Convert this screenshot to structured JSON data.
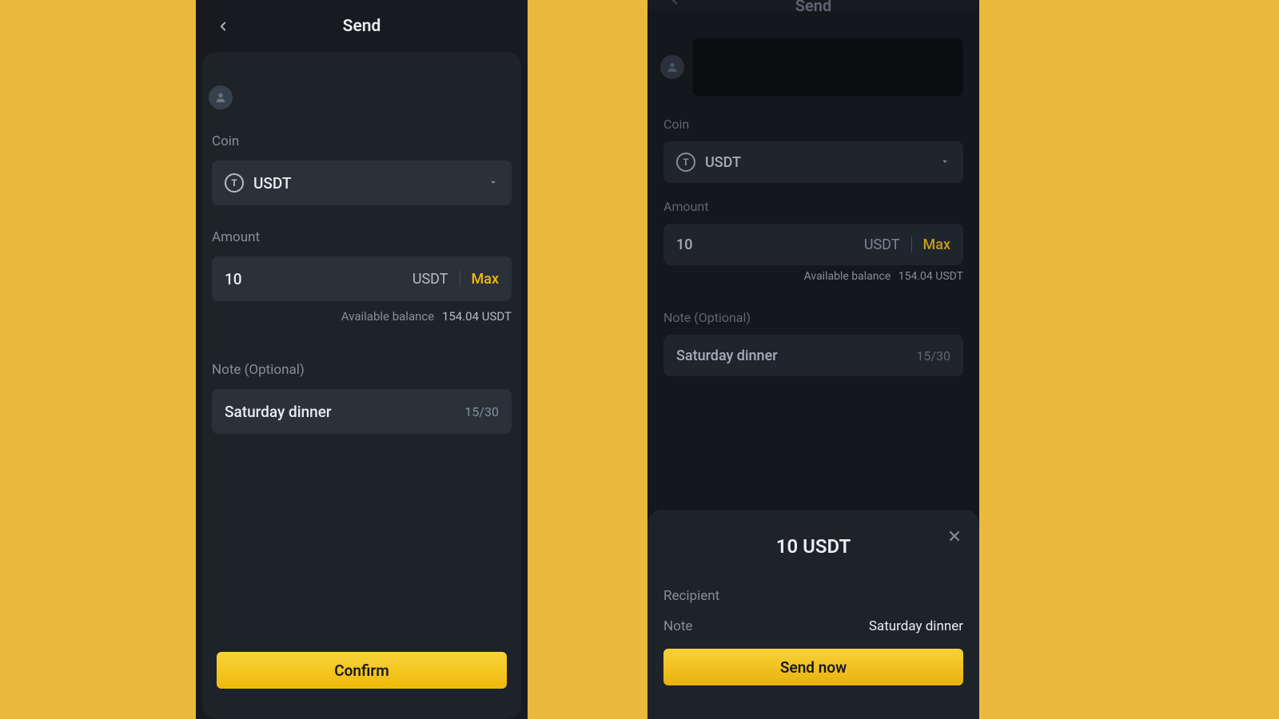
{
  "left": {
    "header": {
      "title": "Send"
    },
    "labels": {
      "coin": "Coin",
      "amount": "Amount",
      "note": "Note (Optional)",
      "available": "Available balance"
    },
    "coin": {
      "symbol": "USDT"
    },
    "amount": {
      "value": "10",
      "unit": "USDT",
      "max": "Max",
      "balance": "154.04 USDT"
    },
    "note": {
      "text": "Saturday dinner",
      "counter": "15/30"
    },
    "confirm": "Confirm"
  },
  "right": {
    "header": {
      "title": "Send"
    },
    "labels": {
      "coin": "Coin",
      "amount": "Amount",
      "note": "Note (Optional)",
      "available": "Available balance"
    },
    "coin": {
      "symbol": "USDT"
    },
    "amount": {
      "value": "10",
      "unit": "USDT",
      "max": "Max",
      "balance": "154.04 USDT"
    },
    "note": {
      "text": "Saturday dinner",
      "counter": "15/30"
    },
    "sheet": {
      "title": "10 USDT",
      "recipient_label": "Recipient",
      "note_label": "Note",
      "note_value": "Saturday dinner",
      "button": "Send now"
    }
  }
}
